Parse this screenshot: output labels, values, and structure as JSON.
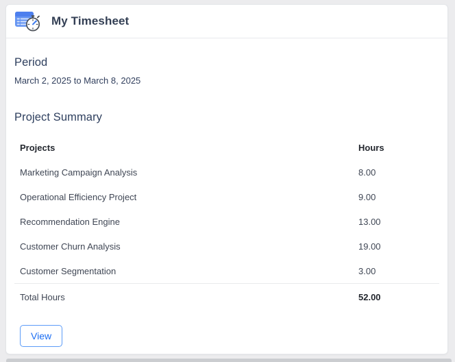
{
  "header": {
    "title": "My Timesheet",
    "icon": "timesheet-stopwatch-icon"
  },
  "period": {
    "heading": "Period",
    "value": "March 2, 2025 to March 8, 2025"
  },
  "summary": {
    "heading": "Project Summary",
    "table": {
      "columns": [
        "Projects",
        "Hours"
      ],
      "rows": [
        {
          "project": "Marketing Campaign Analysis",
          "hours": "8.00"
        },
        {
          "project": "Operational Efficiency Project",
          "hours": "9.00"
        },
        {
          "project": "Recommendation Engine",
          "hours": "13.00"
        },
        {
          "project": "Customer Churn Analysis",
          "hours": "19.00"
        },
        {
          "project": "Customer Segmentation",
          "hours": "3.00"
        }
      ],
      "total": {
        "label": "Total Hours",
        "hours": "52.00"
      }
    }
  },
  "actions": {
    "view_label": "View"
  },
  "colors": {
    "accent_blue": "#1c6ef2",
    "button_border": "#5b9bf8",
    "icon_blue": "#5b8cf0",
    "heading_navy": "#2e3f5e",
    "title_color": "#333f54",
    "body_text": "#3f4654",
    "divider": "#e8e9ec",
    "page_background": "#ececee",
    "card_background": "#ffffff"
  }
}
